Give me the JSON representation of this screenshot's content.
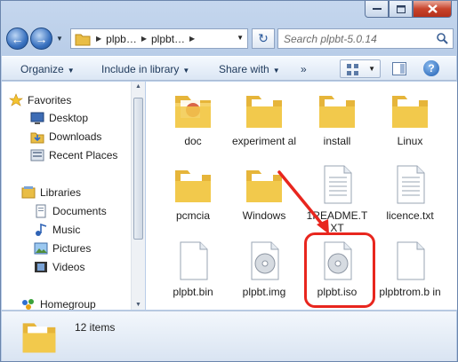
{
  "window": {
    "controls": {
      "minimize_icon": "minimize-icon",
      "maximize_icon": "maximize-icon",
      "close_icon": "close-icon"
    }
  },
  "address": {
    "segments": [
      "plpb…",
      "plpbt…"
    ],
    "search_placeholder": "Search plpbt-5.0.14"
  },
  "toolbar": {
    "organize": "Organize",
    "include_in_library": "Include in library",
    "share_with": "Share with",
    "more": "»"
  },
  "nav": {
    "favorites": {
      "label": "Favorites",
      "items": [
        "Desktop",
        "Downloads",
        "Recent Places"
      ]
    },
    "libraries": {
      "label": "Libraries",
      "items": [
        "Documents",
        "Music",
        "Pictures",
        "Videos"
      ]
    },
    "homegroup": "Homegroup"
  },
  "files": [
    {
      "name": "doc",
      "type": "folder"
    },
    {
      "name": "experimental",
      "type": "folder"
    },
    {
      "name": "install",
      "type": "folder"
    },
    {
      "name": "Linux",
      "type": "folder"
    },
    {
      "name": "pcmcia",
      "type": "folder"
    },
    {
      "name": "Windows",
      "type": "folder"
    },
    {
      "name": "1README.TXT",
      "type": "text"
    },
    {
      "name": "licence.txt",
      "type": "text"
    },
    {
      "name": "plpbt.bin",
      "type": "blank"
    },
    {
      "name": "plpbt.img",
      "type": "disc"
    },
    {
      "name": "plpbt.iso",
      "type": "disc"
    },
    {
      "name": "plpbtrom.bin",
      "type": "blank"
    }
  ],
  "labels": {
    "experimental": "experiment al",
    "readme": "1README.T XT",
    "plpbtrom": "plpbtrom.b in"
  },
  "status": {
    "item_count": "12 items"
  },
  "colors": {
    "annotation": "#e8261e",
    "folder": "#f2c94c"
  }
}
